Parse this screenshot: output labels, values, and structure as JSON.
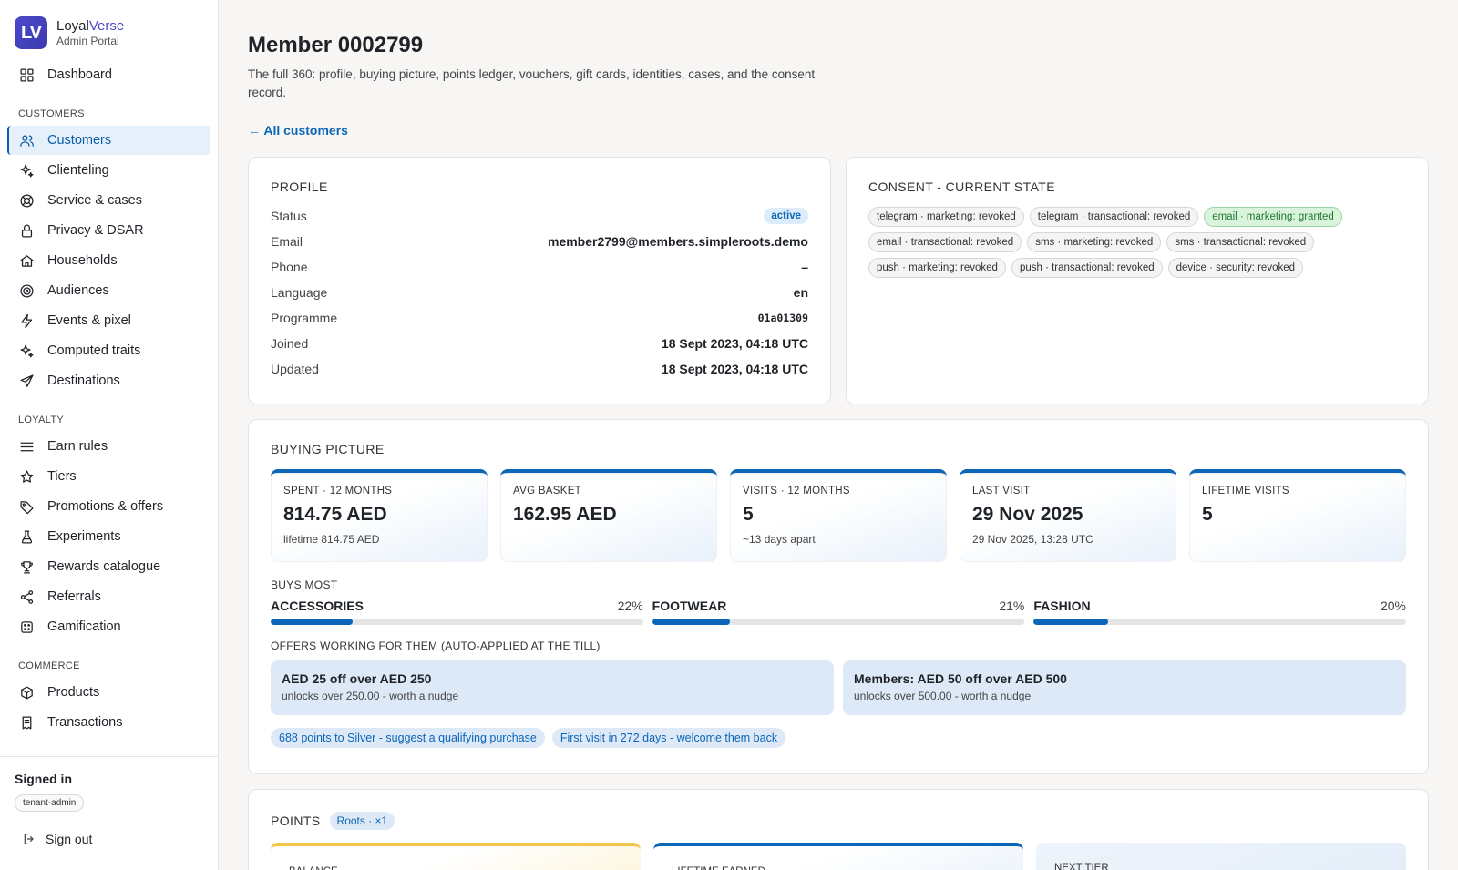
{
  "brand": {
    "logo": "LV",
    "name_a": "Loyal",
    "name_b": "Verse",
    "subtitle": "Admin Portal"
  },
  "sidebar": {
    "top": {
      "label": "Dashboard",
      "icon": "grid-icon"
    },
    "sections": [
      {
        "title": "CUSTOMERS",
        "items": [
          {
            "label": "Customers",
            "icon": "users-icon",
            "active": true
          },
          {
            "label": "Clienteling",
            "icon": "sparkle-icon"
          },
          {
            "label": "Service & cases",
            "icon": "lifebuoy-icon"
          },
          {
            "label": "Privacy & DSAR",
            "icon": "lock-icon"
          },
          {
            "label": "Households",
            "icon": "home-icon"
          },
          {
            "label": "Audiences",
            "icon": "target-icon"
          },
          {
            "label": "Events & pixel",
            "icon": "bolt-icon"
          },
          {
            "label": "Computed traits",
            "icon": "sparkle-icon"
          },
          {
            "label": "Destinations",
            "icon": "send-icon"
          }
        ]
      },
      {
        "title": "LOYALTY",
        "items": [
          {
            "label": "Earn rules",
            "icon": "sliders-icon"
          },
          {
            "label": "Tiers",
            "icon": "star-icon"
          },
          {
            "label": "Promotions & offers",
            "icon": "tag-icon"
          },
          {
            "label": "Experiments",
            "icon": "flask-icon"
          },
          {
            "label": "Rewards catalogue",
            "icon": "trophy-icon"
          },
          {
            "label": "Referrals",
            "icon": "share-icon"
          },
          {
            "label": "Gamification",
            "icon": "dice-icon"
          }
        ]
      },
      {
        "title": "COMMERCE",
        "items": [
          {
            "label": "Products",
            "icon": "box-icon"
          },
          {
            "label": "Transactions",
            "icon": "receipt-icon"
          }
        ]
      }
    ],
    "footer": {
      "signed_in": "Signed in",
      "tenant": "tenant-admin",
      "sign_out": "Sign out"
    }
  },
  "page": {
    "title": "Member 0002799",
    "description": "The full 360: profile, buying picture, points ledger, vouchers, gift cards, identities, cases, and the consent record.",
    "back_link": "← All customers"
  },
  "profile": {
    "title": "PROFILE",
    "status_label": "Status",
    "status": "active",
    "rows": [
      {
        "label": "Email",
        "value": "member2799@members.simpleroots.demo"
      },
      {
        "label": "Phone",
        "value": "–"
      },
      {
        "label": "Language",
        "value": "en"
      },
      {
        "label": "Programme",
        "value": "01a01309"
      },
      {
        "label": "Joined",
        "value": "18 Sept 2023, 04:18 UTC"
      },
      {
        "label": "Updated",
        "value": "18 Sept 2023, 04:18 UTC"
      }
    ]
  },
  "consent": {
    "title": "CONSENT - CURRENT STATE",
    "chips": [
      {
        "text": "telegram · marketing: revoked",
        "granted": false
      },
      {
        "text": "telegram · transactional: revoked",
        "granted": false
      },
      {
        "text": "email · marketing: granted",
        "granted": true
      },
      {
        "text": "email · transactional: revoked",
        "granted": false
      },
      {
        "text": "sms · marketing: revoked",
        "granted": false
      },
      {
        "text": "sms · transactional: revoked",
        "granted": false
      },
      {
        "text": "push · marketing: revoked",
        "granted": false
      },
      {
        "text": "push · transactional: revoked",
        "granted": false
      },
      {
        "text": "device · security: revoked",
        "granted": false
      }
    ]
  },
  "buying": {
    "title": "BUYING PICTURE",
    "stats": [
      {
        "label": "SPENT · 12 MONTHS",
        "value": "814.75 AED",
        "sub": "lifetime 814.75 AED"
      },
      {
        "label": "AVG BASKET",
        "value": "162.95 AED",
        "sub": ""
      },
      {
        "label": "VISITS · 12 MONTHS",
        "value": "5",
        "sub": "~13 days apart"
      },
      {
        "label": "LAST VISIT",
        "value": "29 Nov 2025",
        "sub": "29 Nov 2025, 13:28 UTC"
      },
      {
        "label": "LIFETIME VISITS",
        "value": "5",
        "sub": ""
      }
    ],
    "buys_most_label": "BUYS MOST",
    "buys_most": [
      {
        "name": "ACCESSORIES",
        "pct": "22%",
        "share": 0.22
      },
      {
        "name": "FOOTWEAR",
        "pct": "21%",
        "share": 0.21
      },
      {
        "name": "FASHION",
        "pct": "20%",
        "share": 0.2
      }
    ],
    "offers_label": "OFFERS WORKING FOR THEM (AUTO-APPLIED AT THE TILL)",
    "offers": [
      {
        "title": "AED 25 off over AED 250",
        "sub": "unlocks over 250.00 - worth a nudge"
      },
      {
        "title": "Members: AED 50 off over AED 500",
        "sub": "unlocks over 500.00 - worth a nudge"
      }
    ],
    "tips": [
      "688 points to Silver - suggest a qualifying purchase",
      "First visit in 272 days - welcome them back"
    ]
  },
  "points": {
    "title": "POINTS",
    "pill": "Roots · ×1",
    "stats": [
      "BALANCE",
      "LIFETIME EARNED",
      "NEXT TIER"
    ]
  },
  "colors": {
    "accent": "#0b66b8",
    "brand": "#4b49c9",
    "granted": "#1d7a2d"
  }
}
